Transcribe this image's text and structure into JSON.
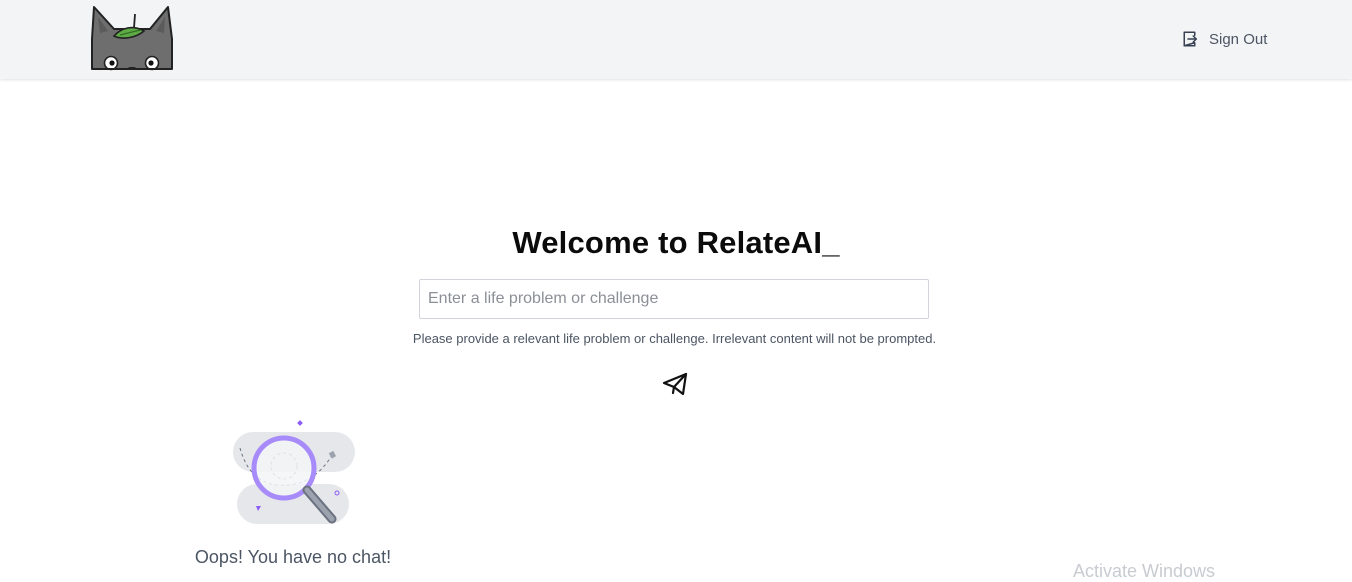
{
  "header": {
    "logo_icon": "totoro-peeking-logo",
    "sign_out_label": "Sign Out",
    "sign_out_icon": "sign-out-icon"
  },
  "main": {
    "title": "Welcome to RelateAI_",
    "input": {
      "placeholder": "Enter a life problem or challenge",
      "value": ""
    },
    "hint": "Please provide a relevant life problem or challenge. Irrelevant content will not be prompted.",
    "send_icon": "paper-plane-icon"
  },
  "empty_state": {
    "illustration": "magnifying-glass-illustration",
    "message": "Oops! You have no chat!"
  },
  "watermark": "Activate Windows",
  "colors": {
    "header_bg": "#f3f4f6",
    "text_muted": "#4b5563",
    "illustration_accent": "#a78bfa"
  }
}
